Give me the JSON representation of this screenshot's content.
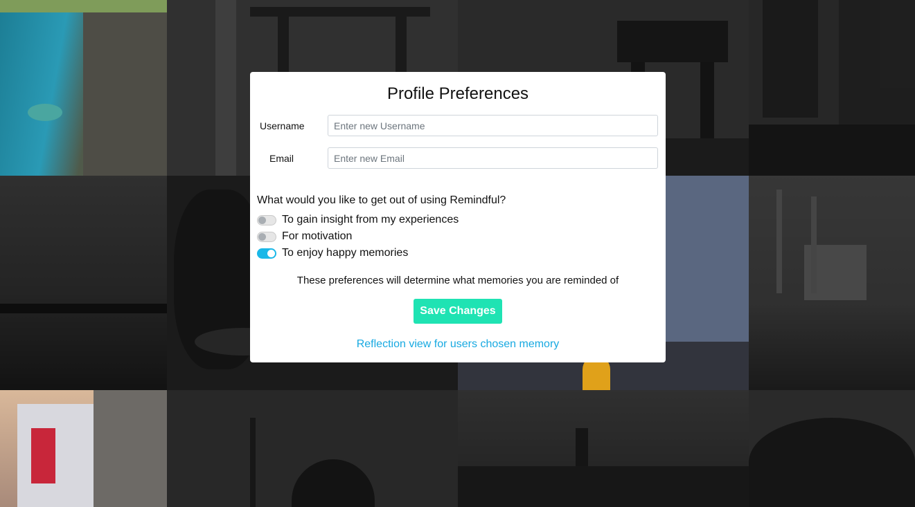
{
  "modal": {
    "title": "Profile Preferences",
    "username_label": "Username",
    "username_placeholder": "Enter new Username",
    "username_value": "",
    "email_label": "Email",
    "email_placeholder": "Enter new Email",
    "email_value": "",
    "question": "What would you like to get out of using Remindful?",
    "preferences": [
      {
        "label": "To gain insight from my experiences",
        "enabled": false
      },
      {
        "label": "For motivation",
        "enabled": false
      },
      {
        "label": "To enjoy happy memories",
        "enabled": true
      }
    ],
    "note": "These preferences will determine what memories you are reminded of",
    "save_label": "Save Changes",
    "reflection_link": "Reflection view for users chosen memory"
  },
  "colors": {
    "accent_button": "#1fe3b3",
    "toggle_on": "#1ab8e8",
    "link": "#17a9e1"
  },
  "background": {
    "tiles": [
      {
        "name": "bg-photo-sea-cliff",
        "colored": true
      },
      {
        "name": "bg-photo-torii-gate"
      },
      {
        "name": "bg-photo-chinese-gate"
      },
      {
        "name": "bg-photo-city-street"
      },
      {
        "name": "bg-photo-river-bridge"
      },
      {
        "name": "bg-photo-trees"
      },
      {
        "name": "bg-photo-market-crowd",
        "colored": true
      },
      {
        "name": "bg-photo-mosque-waterfront"
      },
      {
        "name": "bg-photo-hotel-street",
        "colored": true
      },
      {
        "name": "bg-photo-mosque-domes"
      },
      {
        "name": "bg-photo-city-skyline"
      },
      {
        "name": "bg-photo-forest-hill"
      }
    ]
  }
}
